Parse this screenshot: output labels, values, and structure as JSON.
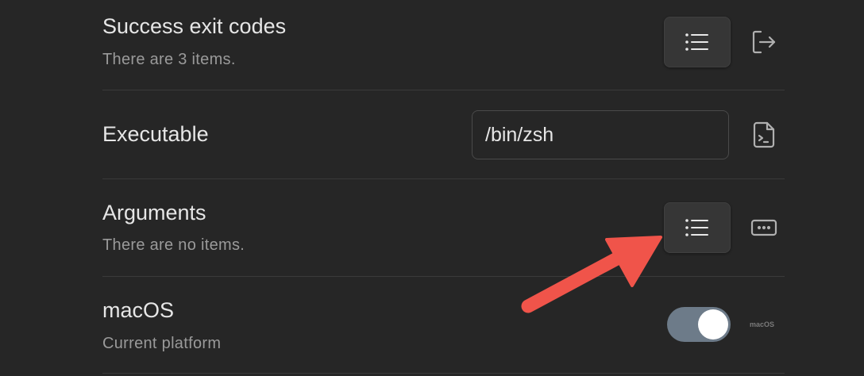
{
  "settings": {
    "success_exit_codes": {
      "title": "Success exit codes",
      "description": "There are 3 items."
    },
    "executable": {
      "title": "Executable",
      "value": "/bin/zsh"
    },
    "arguments": {
      "title": "Arguments",
      "description": "There are no items."
    },
    "platform": {
      "title": "macOS",
      "description": "Current platform",
      "enabled": true,
      "tag": "macOS"
    }
  },
  "icons": {
    "list": "list-icon",
    "exit": "exit-icon",
    "terminal_file": "terminal-file-icon",
    "arguments": "ellipsis-box-icon",
    "annotation": "red-arrow"
  },
  "colors": {
    "background": "#262626",
    "button": "#363636",
    "toggle_on": "#6d7b89",
    "annotation_arrow": "#f0544a"
  }
}
